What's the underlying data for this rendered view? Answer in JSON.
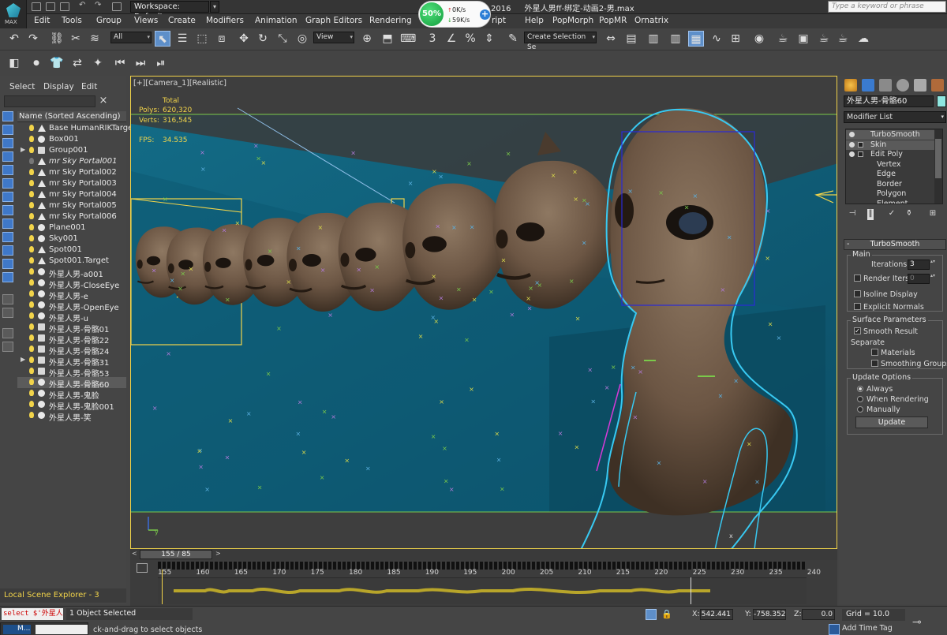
{
  "titlebar": {
    "app_logo_text": "MAX",
    "workspace": "Workspace: Default",
    "workspace_drop": "▾",
    "doc_year": "2016",
    "doc_title": "外星人男ff-绑定-动画2-男.max",
    "search_placeholder": "Type a keyword or phrase"
  },
  "net_monitor": {
    "percent": "50%",
    "up": "0K/s",
    "down": "59K/s",
    "up_arrow": "↑",
    "down_arrow": "↓",
    "plus": "+"
  },
  "menus": [
    "Edit",
    "Tools",
    "Group",
    "Views",
    "Create",
    "Modifiers",
    "Animation",
    "Graph Editors",
    "Rendering",
    "ript",
    "Help",
    "PopMorph",
    "PopMR",
    "Ornatrix"
  ],
  "toolbar": {
    "selection_filter": "All",
    "ref_coord": "View",
    "named_selection": "Create Selection Se",
    "dd": "▾",
    "undo_icon": "↶",
    "redo_icon": "↷",
    "link_icon": "⛓",
    "unlink_icon": "✂",
    "bind_icon": "≋",
    "select_icon": "⬉",
    "select_name_icon": "☰",
    "rect_region_icon": "⬚",
    "window_icon": "⧈",
    "move_icon": "✥",
    "rotate_icon": "↻",
    "scale_icon": "⤡",
    "place_icon": "◎",
    "pivot_icon": "⊕",
    "manip_icon": "⬒",
    "keyboard_icon": "⌨",
    "snap_icon": "3",
    "angle_snap_icon": "∠",
    "percent_snap_icon": "%",
    "spinner_snap_icon": "⇕",
    "edit_named_icon": "✎",
    "mirror_icon": "⇔",
    "align_icon": "▤",
    "layer_icon": "▥",
    "ribbon_icon": "▦",
    "curve_editor_icon": "∿",
    "schematic_icon": "⊞",
    "material_icon": "◉",
    "render_setup_icon": "☕",
    "render_frame_icon": "▣",
    "render_icon": "☕",
    "render_iter_icon": "☕",
    "a360_icon": "☁"
  },
  "toolbar2": {
    "icons": [
      "◧",
      "●",
      "👕",
      "⇄",
      "✦",
      "⏮",
      "⏭",
      "⏯"
    ]
  },
  "scene_explorer": {
    "tabs": [
      "Select",
      "Display",
      "Edit"
    ],
    "clear": "×",
    "column_header": "Name (Sorted Ascending)",
    "footer": "Local Scene Explorer - 3",
    "rows": [
      {
        "label": "Base HumanRIKTarget",
        "exp": "",
        "bulb": true,
        "type": "light",
        "italic": false,
        "sel": false
      },
      {
        "label": "Box001",
        "exp": "",
        "bulb": true,
        "type": "obj",
        "italic": false,
        "sel": false
      },
      {
        "label": "Group001",
        "exp": "▶",
        "bulb": true,
        "type": "group",
        "italic": false,
        "sel": false
      },
      {
        "label": "mr Sky Portal001",
        "exp": "",
        "bulb": false,
        "type": "light",
        "italic": true,
        "sel": false
      },
      {
        "label": "mr Sky Portal002",
        "exp": "",
        "bulb": true,
        "type": "light",
        "italic": false,
        "sel": false
      },
      {
        "label": "mr Sky Portal003",
        "exp": "",
        "bulb": true,
        "type": "light",
        "italic": false,
        "sel": false
      },
      {
        "label": "mr Sky Portal004",
        "exp": "",
        "bulb": true,
        "type": "light",
        "italic": false,
        "sel": false
      },
      {
        "label": "mr Sky Portal005",
        "exp": "",
        "bulb": true,
        "type": "light",
        "italic": false,
        "sel": false
      },
      {
        "label": "mr Sky Portal006",
        "exp": "",
        "bulb": true,
        "type": "light",
        "italic": false,
        "sel": false
      },
      {
        "label": "Plane001",
        "exp": "",
        "bulb": true,
        "type": "obj",
        "italic": false,
        "sel": false
      },
      {
        "label": "Sky001",
        "exp": "",
        "bulb": true,
        "type": "obj",
        "italic": false,
        "sel": false
      },
      {
        "label": "Spot001",
        "exp": "",
        "bulb": true,
        "type": "light",
        "italic": false,
        "sel": false
      },
      {
        "label": "Spot001.Target",
        "exp": "",
        "bulb": true,
        "type": "light",
        "italic": false,
        "sel": false
      },
      {
        "label": "外星人男-a001",
        "exp": "",
        "bulb": true,
        "type": "obj",
        "italic": false,
        "sel": false
      },
      {
        "label": "外星人男-CloseEye",
        "exp": "",
        "bulb": true,
        "type": "obj",
        "italic": false,
        "sel": false
      },
      {
        "label": "外星人男-e",
        "exp": "",
        "bulb": true,
        "type": "obj",
        "italic": false,
        "sel": false
      },
      {
        "label": "外星人男-OpenEye",
        "exp": "",
        "bulb": true,
        "type": "obj",
        "italic": false,
        "sel": false
      },
      {
        "label": "外星人男-u",
        "exp": "",
        "bulb": true,
        "type": "obj",
        "italic": false,
        "sel": false
      },
      {
        "label": "外星人男-骨骼01",
        "exp": "",
        "bulb": true,
        "type": "group",
        "italic": false,
        "sel": false
      },
      {
        "label": "外星人男-骨骼22",
        "exp": "",
        "bulb": true,
        "type": "group",
        "italic": false,
        "sel": false
      },
      {
        "label": "外星人男-骨骼24",
        "exp": "",
        "bulb": true,
        "type": "group",
        "italic": false,
        "sel": false
      },
      {
        "label": "外星人男-骨骼31",
        "exp": "▶",
        "bulb": true,
        "type": "group",
        "italic": false,
        "sel": false
      },
      {
        "label": "外星人男-骨骼53",
        "exp": "",
        "bulb": true,
        "type": "group",
        "italic": false,
        "sel": false
      },
      {
        "label": "外星人男-骨骼60",
        "exp": "",
        "bulb": true,
        "type": "obj",
        "italic": false,
        "sel": true
      },
      {
        "label": "外星人男-鬼脸",
        "exp": "",
        "bulb": true,
        "type": "obj",
        "italic": false,
        "sel": false
      },
      {
        "label": "外星人男-鬼脸001",
        "exp": "",
        "bulb": true,
        "type": "obj",
        "italic": false,
        "sel": false
      },
      {
        "label": "外星人男-笑",
        "exp": "",
        "bulb": true,
        "type": "obj",
        "italic": false,
        "sel": false
      }
    ]
  },
  "viewport": {
    "label": "[+][Camera_1][Realistic]",
    "stats": {
      "total": "Total",
      "polys_label": "Polys:",
      "polys": "620,320",
      "verts_label": "Verts:",
      "verts": "316,545",
      "fps_label": "FPS:",
      "fps": "34.535"
    },
    "axis_y": "y",
    "axis_x": "x"
  },
  "command_panel": {
    "object_name": "外星人男-骨骼60",
    "modifier_list": "Modifier List",
    "dd": "▾",
    "stack": [
      {
        "label": "TurboSmooth",
        "kind": "mod",
        "eye": true,
        "box": false
      },
      {
        "label": "Skin",
        "kind": "mod",
        "eye": true,
        "box": true
      },
      {
        "label": "Edit Poly",
        "kind": "item",
        "eye": true,
        "box": true
      },
      {
        "label": "Vertex",
        "kind": "sub",
        "eye": false,
        "box": false
      },
      {
        "label": "Edge",
        "kind": "sub",
        "eye": false,
        "box": false
      },
      {
        "label": "Border",
        "kind": "sub",
        "eye": false,
        "box": false
      },
      {
        "label": "Polygon",
        "kind": "sub",
        "eye": false,
        "box": false
      },
      {
        "label": "Element",
        "kind": "sub",
        "eye": false,
        "box": false
      }
    ],
    "stack_tools": [
      "⊣",
      "‖",
      "✓",
      "⚱",
      "⊞"
    ],
    "rollout_title": "TurboSmooth",
    "rollout_minus": "-",
    "main_group": "Main",
    "iterations_label": "Iterations:",
    "iterations": "3",
    "render_iters_label": "Render Iters:",
    "render_iters": "0",
    "isoline_label": "Isoline Display",
    "explicit_normals_label": "Explicit Normals",
    "surface_group": "Surface Parameters",
    "smooth_result_label": "Smooth Result",
    "check_mark": "✓",
    "separate_label": "Separate",
    "materials_label": "Materials",
    "smoothing_groups_label": "Smoothing Groups",
    "update_group": "Update Options",
    "always_label": "Always",
    "when_rendering_label": "When Rendering",
    "manually_label": "Manually",
    "update_button": "Update",
    "spin": "▴▾"
  },
  "timeline": {
    "slider": "155 / 85",
    "prev": "<",
    "next": ">",
    "ticks": [
      "155",
      "160",
      "165",
      "170",
      "175",
      "180",
      "185",
      "190",
      "195",
      "200",
      "205",
      "210",
      "215",
      "220",
      "225",
      "230",
      "235",
      "240"
    ]
  },
  "statusbar": {
    "maxscript": "select $'外星人",
    "selection": "1 Object Selected",
    "prompt": "ck-and-drag to select objects",
    "task_label": "M...",
    "x_label": "X:",
    "x": "542.441",
    "y_label": "Y:",
    "y": "-758.352",
    "z_label": "Z:",
    "z": "0.0",
    "grid": "Grid = 10.0",
    "add_time_tag": "Add Time Tag",
    "key_icon": "⊸",
    "lock_icon": "🔒"
  },
  "colors": {
    "accent": "#5e8fc9",
    "viewport_bg": "#0f5a72",
    "selection_outline": "#38c9f2",
    "highlight_yellow": "#f2d44a",
    "head_skin": "#7a6450"
  }
}
